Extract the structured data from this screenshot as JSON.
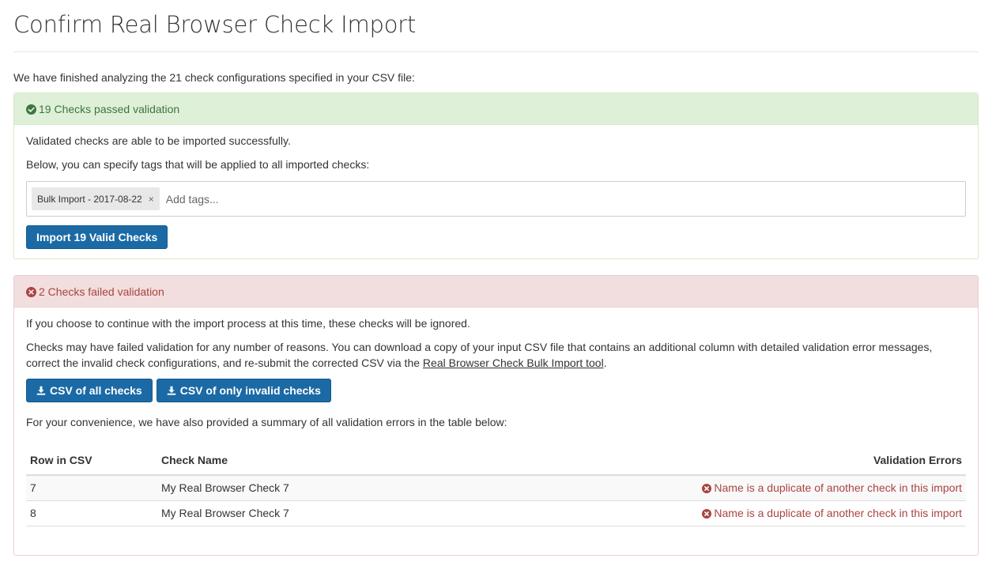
{
  "page": {
    "title": "Confirm Real Browser Check Import",
    "intro": "We have finished analyzing the 21 check configurations specified in your CSV file:"
  },
  "colors": {
    "success_bg": "#dff0d8",
    "success_text": "#3c763d",
    "danger_bg": "#f2dede",
    "danger_text": "#a94442",
    "primary_button": "#1b6aa5"
  },
  "passed": {
    "heading_icon": "check-circle-icon",
    "heading": "19 Checks passed validation",
    "line1": "Validated checks are able to be imported successfully.",
    "line2": "Below, you can specify tags that will be applied to all imported checks:",
    "tags": [
      "Bulk Import - 2017-08-22"
    ],
    "tag_remove_glyph": "×",
    "tags_placeholder": "Add tags...",
    "import_button": "Import 19 Valid Checks"
  },
  "failed": {
    "heading_icon": "times-circle-icon",
    "heading": "2 Checks failed validation",
    "line1": "If you choose to continue with the import process at this time, these checks will be ignored.",
    "line2_part1": "Checks may have failed validation for any number of reasons. You can download a copy of your input CSV file that contains an additional column with detailed validation error messages, correct the invalid check configurations, and re-submit the corrected CSV via the ",
    "line2_link": "Real Browser Check Bulk Import tool",
    "line2_part2": ".",
    "csv_all_button": "CSV of all checks",
    "csv_invalid_button": "CSV of only invalid checks",
    "download_icon": "download-icon",
    "summary": "For your convenience, we have also provided a summary of all validation errors in the table below:",
    "table": {
      "headers": [
        "Row in CSV",
        "Check Name",
        "Validation Errors"
      ],
      "rows": [
        {
          "row": "7",
          "name": "My Real Browser Check 7",
          "error": "Name is a duplicate of another check in this import"
        },
        {
          "row": "8",
          "name": "My Real Browser Check 7",
          "error": "Name is a duplicate of another check in this import"
        }
      ]
    }
  }
}
